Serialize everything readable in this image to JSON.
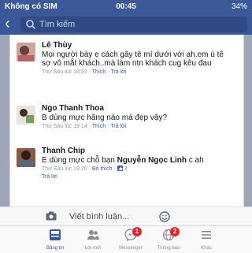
{
  "status_bar": {
    "carrier": "Không có SIM",
    "time": "00:45",
    "battery": "34%"
  },
  "navbar": {
    "search_placeholder": "Tìm kiếm"
  },
  "comments": [
    {
      "name": "Lê Thùy",
      "text": "Mọi người bày e cách gãy tê mí dưới với ah.em ú tê sợ vô mắt khách..mà làm ntn khách cug kêu đau",
      "time": "Thứ Sáu lúc 18:53",
      "like": "Thích",
      "reply": "Trả lời"
    },
    {
      "name": "Ngo Thanh Thoa",
      "text": "B dùng mực hãng nào mà đẹp vậy?",
      "time": "Thứ Sáu lúc 19:14",
      "like": "Thích",
      "reply": "Trả lời"
    },
    {
      "name": "Thanh Chip",
      "text_prefix": "E dùng mực chỗ bạn ",
      "mention": "Nguyễn Ngọc Linh",
      "text_suffix": " c ah",
      "time": "Thứ Sáu lúc 19:20",
      "like": "Bỏ thích",
      "like_count": "3",
      "reply": "Trả lời"
    }
  ],
  "composer": {
    "placeholder": "Viết bình luận..."
  },
  "tabs": [
    {
      "label": "Bảng tin",
      "icon": "news-feed-icon",
      "active": true
    },
    {
      "label": "Lời mời",
      "icon": "friend-requests-icon"
    },
    {
      "label": "Messenger",
      "icon": "messenger-icon",
      "badge": "1"
    },
    {
      "label": "Thông báo",
      "icon": "globe-icon",
      "badge": "2"
    },
    {
      "label": "Khác",
      "icon": "menu-icon"
    }
  ],
  "colors": {
    "brand": "#3b5998",
    "badge": "#e0242a",
    "meta": "#9197a3"
  }
}
